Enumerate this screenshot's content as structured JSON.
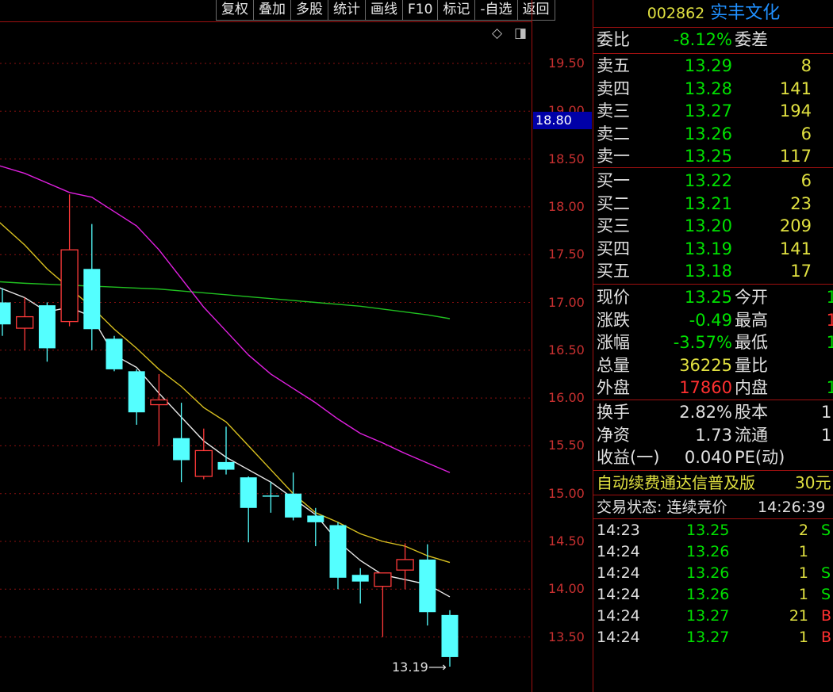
{
  "toolbar": [
    "复权",
    "叠加",
    "多股",
    "统计",
    "画线",
    "F10",
    "标记",
    "-自选",
    "返回"
  ],
  "chart_icons": {
    "diamond": "◇",
    "window": "◨"
  },
  "price_axis": [
    "19.50",
    "19.00",
    "18.50",
    "18.00",
    "17.50",
    "17.00",
    "16.50",
    "16.00",
    "15.50",
    "15.00",
    "14.50",
    "14.00",
    "13.50"
  ],
  "current_price_label": "18.80",
  "low_marker": "13.19",
  "header": {
    "code": "002862",
    "name": "实丰文化"
  },
  "weibi": {
    "label": "委比",
    "value": "-8.12%",
    "label2": "委差"
  },
  "sell": [
    {
      "label": "卖五",
      "price": "13.29",
      "vol": "8"
    },
    {
      "label": "卖四",
      "price": "13.28",
      "vol": "141"
    },
    {
      "label": "卖三",
      "price": "13.27",
      "vol": "194"
    },
    {
      "label": "卖二",
      "price": "13.26",
      "vol": "6"
    },
    {
      "label": "卖一",
      "price": "13.25",
      "vol": "117"
    }
  ],
  "buy": [
    {
      "label": "买一",
      "price": "13.22",
      "vol": "6"
    },
    {
      "label": "买二",
      "price": "13.21",
      "vol": "23"
    },
    {
      "label": "买三",
      "price": "13.20",
      "vol": "209"
    },
    {
      "label": "买四",
      "price": "13.19",
      "vol": "141"
    },
    {
      "label": "买五",
      "price": "13.18",
      "vol": "17"
    }
  ],
  "quote": [
    {
      "label": "现价",
      "value": "13.25",
      "label2": "今开",
      "value2": "1"
    },
    {
      "label": "涨跌",
      "value": "-0.49",
      "label2": "最高",
      "value2": "1"
    },
    {
      "label": "涨幅",
      "value": "-3.57%",
      "label2": "最低",
      "value2": "1"
    },
    {
      "label": "总量",
      "value": "36225",
      "label2": "量比",
      "value2": ""
    },
    {
      "label": "外盘",
      "value": "17860",
      "label2": "内盘",
      "value2": "1"
    }
  ],
  "fund": [
    {
      "label": "换手",
      "value": "2.82%",
      "label2": "股本",
      "value2": "1."
    },
    {
      "label": "净资",
      "value": "1.73",
      "label2": "流通",
      "value2": "1."
    },
    {
      "label": "收益(一)",
      "value": "0.040",
      "label2": "PE(动)",
      "value2": ""
    }
  ],
  "ad": {
    "text": "自动续费通达信普及版",
    "price": "30元"
  },
  "trade_status": {
    "text": "交易状态: 连续竞价",
    "time": "14:26:39"
  },
  "ticks": [
    {
      "time": "14:23",
      "price": "13.25",
      "vol": "2",
      "bs": "S"
    },
    {
      "time": "14:24",
      "price": "13.26",
      "vol": "1",
      "bs": ""
    },
    {
      "time": "14:24",
      "price": "13.26",
      "vol": "1",
      "bs": "S"
    },
    {
      "time": "14:24",
      "price": "13.26",
      "vol": "1",
      "bs": "S"
    },
    {
      "time": "14:24",
      "price": "13.27",
      "vol": "21",
      "bs": "B"
    },
    {
      "time": "14:24",
      "price": "13.27",
      "vol": "1",
      "bs": "B"
    }
  ],
  "chart_data": {
    "type": "candlestick",
    "y_range": [
      13.0,
      19.9
    ],
    "candles": [
      {
        "o": 17.0,
        "c": 16.77,
        "h": 17.15,
        "l": 16.65
      },
      {
        "o": 16.73,
        "c": 16.85,
        "h": 17.05,
        "l": 16.5
      },
      {
        "o": 16.97,
        "c": 16.52,
        "h": 17.0,
        "l": 16.38
      },
      {
        "o": 16.8,
        "c": 17.55,
        "h": 18.13,
        "l": 16.75
      },
      {
        "o": 17.35,
        "c": 16.72,
        "h": 17.82,
        "l": 16.5
      },
      {
        "o": 16.62,
        "c": 16.3,
        "h": 16.65,
        "l": 16.28
      },
      {
        "o": 16.28,
        "c": 15.85,
        "h": 16.3,
        "l": 15.72
      },
      {
        "o": 15.93,
        "c": 15.98,
        "h": 16.25,
        "l": 15.5
      },
      {
        "o": 15.58,
        "c": 15.35,
        "h": 15.95,
        "l": 15.12
      },
      {
        "o": 15.18,
        "c": 15.45,
        "h": 15.68,
        "l": 15.15
      },
      {
        "o": 15.33,
        "c": 15.25,
        "h": 15.7,
        "l": 15.2
      },
      {
        "o": 15.17,
        "c": 14.85,
        "h": 15.18,
        "l": 14.49
      },
      {
        "o": 14.98,
        "c": 14.97,
        "h": 15.12,
        "l": 14.8
      },
      {
        "o": 15.0,
        "c": 14.75,
        "h": 15.22,
        "l": 14.72
      },
      {
        "o": 14.77,
        "c": 14.7,
        "h": 14.85,
        "l": 14.45
      },
      {
        "o": 14.67,
        "c": 14.12,
        "h": 14.7,
        "l": 14.0
      },
      {
        "o": 14.15,
        "c": 14.08,
        "h": 14.22,
        "l": 13.85
      },
      {
        "o": 14.03,
        "c": 14.17,
        "h": 14.17,
        "l": 13.5
      },
      {
        "o": 14.2,
        "c": 14.31,
        "h": 14.48,
        "l": 14.0
      },
      {
        "o": 14.31,
        "c": 13.76,
        "h": 14.47,
        "l": 13.62
      },
      {
        "o": 13.73,
        "c": 13.29,
        "h": 13.78,
        "l": 13.19
      }
    ],
    "ma_white": [
      17.18,
      17.05,
      16.9,
      16.95,
      16.85,
      16.45,
      16.32,
      16.05,
      15.8,
      15.55,
      15.38,
      15.25,
      15.12,
      14.95,
      14.78,
      14.5,
      14.3,
      14.15,
      14.1,
      14.05,
      13.92
    ],
    "ma_yellow": [
      17.9,
      17.6,
      17.35,
      17.15,
      16.95,
      16.72,
      16.52,
      16.3,
      16.12,
      15.9,
      15.75,
      15.5,
      15.25,
      15.0,
      14.8,
      14.7,
      14.58,
      14.5,
      14.45,
      14.35,
      14.28
    ],
    "ma_magenta": [
      18.45,
      18.35,
      18.25,
      18.15,
      18.1,
      17.95,
      17.8,
      17.55,
      17.25,
      16.95,
      16.7,
      16.45,
      16.25,
      16.1,
      15.95,
      15.78,
      15.63,
      15.53,
      15.42,
      15.32,
      15.22
    ],
    "ma_green": [
      17.22,
      17.2,
      17.19,
      17.18,
      17.17,
      17.16,
      17.15,
      17.14,
      17.12,
      17.1,
      17.08,
      17.06,
      17.04,
      17.02,
      17.0,
      16.98,
      16.96,
      16.93,
      16.9,
      16.87,
      16.83
    ]
  }
}
